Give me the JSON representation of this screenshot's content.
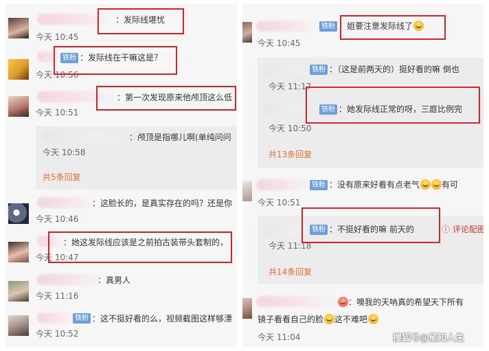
{
  "left": {
    "c1": {
      "text": "：发际线堪忧",
      "time": "今天 10:45"
    },
    "c2": {
      "badge": "铁粉",
      "text": "：发际线在干嘛这是？",
      "time": "今天 10:56"
    },
    "c3": {
      "text": "：第一次发现原来他颅顶这么低",
      "time": "今天 10:51",
      "reply": {
        "text": "：颅顶是指哪儿啊(单纯问问",
        "time": "今天 10:58"
      },
      "count": "共5条回复"
    },
    "c4": {
      "text": "：这脸长的，是真实存在的吗？还是你",
      "time": "今天 10:46"
    },
    "c5": {
      "text": "：她这发际线应该是之前拍古装带头套制的，",
      "time": "今天 10:47"
    },
    "c6": {
      "text": "：真男人",
      "time": "今天 11:16"
    },
    "c7": {
      "badge": "铁粉",
      "text": "：这不挺好看的么，视频截图这样够漂",
      "time": "今天 10:52"
    }
  },
  "right": {
    "c1": {
      "badge": "铁粉",
      "text": "：姐要注意发际线了",
      "time": "今天 10:45",
      "replies": [
        {
          "badge": "铁粉",
          "text": "：（这是前两天的）挺好看的嘛 倒也",
          "time": "今天 11:17"
        },
        {
          "badge": "铁粉",
          "text": "：她发际线正常的呀，三庭比例完",
          "time": "今天 10:50"
        }
      ],
      "count": "共13条回复"
    },
    "c2": {
      "badge": "铁粉",
      "text": "：没有原来好看有点老气",
      "text_tail": "有可",
      "time": "今天 10:51",
      "reply": {
        "badge": "铁粉",
        "text": "：不挺好看的嘛 前天的",
        "like": "ⓘ 评论配图",
        "time": "今天 11:18"
      },
      "count": "共14条回复"
    },
    "c3": {
      "text": "：噢我的天呐真的希望天下所有",
      "line2": "镜子看看自己的脸",
      "line2_tail": "这不难吧",
      "time": "今天 11:04"
    }
  },
  "watermark": "搜狐号@星知人生",
  "colors": {
    "highlight": "#d92128",
    "badge": "#6b9fe0",
    "reply_count": "#e86d32"
  }
}
